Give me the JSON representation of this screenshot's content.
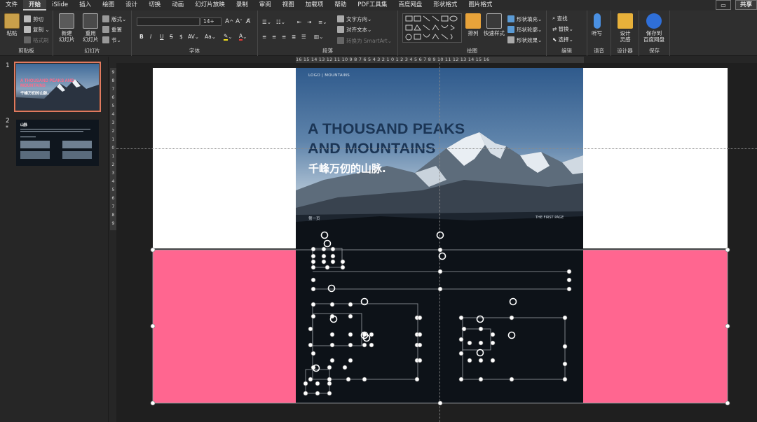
{
  "menu": {
    "tabs": [
      "文件",
      "开始",
      "iSlide",
      "插入",
      "绘图",
      "设计",
      "切换",
      "动画",
      "幻灯片放映",
      "录制",
      "审阅",
      "视图",
      "加载项",
      "帮助",
      "PDF工具集",
      "百度网盘",
      "形状格式",
      "图片格式"
    ],
    "active_index": 1,
    "comment_icon": "comment-icon",
    "share_label": "共享"
  },
  "ribbon": {
    "clipboard": {
      "paste": "粘贴",
      "cut": "剪切",
      "copy": "复制",
      "format_painter": "格式刷",
      "label": "剪贴板"
    },
    "slides": {
      "new_slide": "新建\n幻灯片",
      "reuse": "重用\n幻灯片",
      "layout": "版式",
      "reset": "重置",
      "section": "节",
      "label": "幻灯片"
    },
    "font": {
      "font_name": "",
      "font_size": "14+",
      "label": "字体",
      "buttons": [
        "B",
        "I",
        "U",
        "S",
        "ab",
        "AV",
        "Aa"
      ]
    },
    "paragraph": {
      "text_direction": "文字方向",
      "align_text": "对齐文本",
      "smartart": "转换为 SmartArt",
      "label": "段落"
    },
    "drawing": {
      "arrange": "排列",
      "quick_styles": "快速样式",
      "fill": "形状填充",
      "outline": "形状轮廓",
      "effects": "形状效果",
      "label": "绘图"
    },
    "editing": {
      "find": "查找",
      "replace": "替换",
      "select": "选择",
      "label": "编辑"
    },
    "voice": {
      "dictate": "听写",
      "label": "语音"
    },
    "designer": {
      "design_ideas": "设计\n灵感",
      "label": "设计器"
    },
    "save": {
      "save_baidu": "保存到\n百度网盘",
      "label": "保存"
    }
  },
  "thumbnails": [
    {
      "number": "1",
      "title": "A THOUSAND PEAKS AND MOUNTAINS",
      "sub": "千峰万仞的山脉。"
    },
    {
      "number": "2",
      "title": "山脉"
    }
  ],
  "rulers": {
    "horizontal": "16 15 14 13 12 11 10 9 8 7 6 5 4 3 2 1 0 1 2 3 4 5 6 7 8 9 10 11 12 13 14 15 16",
    "vertical": [
      "9",
      "8",
      "7",
      "6",
      "5",
      "4",
      "3",
      "2",
      "1",
      "0",
      "1",
      "2",
      "3",
      "4",
      "5",
      "6",
      "7",
      "8",
      "9"
    ]
  },
  "slide": {
    "logo": "LOGO | MOUNTAINS",
    "title_line1": "A THOUSAND PEAKS",
    "title_line2": "AND MOUNTAINS",
    "subtitle": "千峰万仞的山脉.",
    "first_label": "第一页",
    "page_label": "THE FIRST PAGE"
  },
  "colors": {
    "selection_fill": "#ff6690",
    "title_color": "#1b3555",
    "thumb_outline": "#e07a5f"
  }
}
